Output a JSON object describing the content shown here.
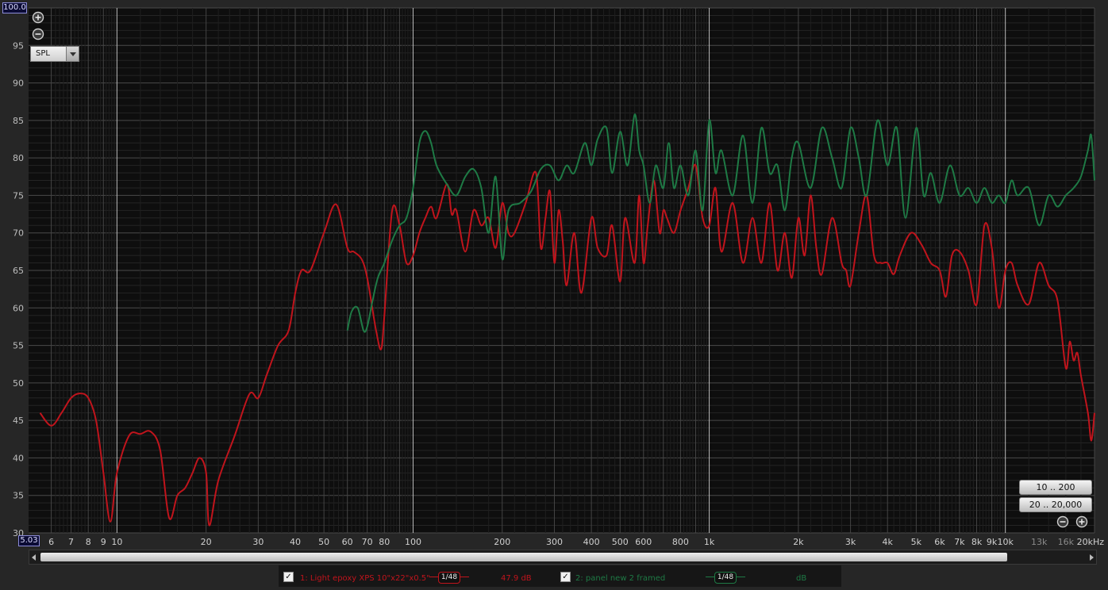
{
  "chart_data": {
    "type": "line",
    "title": "",
    "xlabel": "",
    "ylabel": "",
    "x_scale": "log",
    "xlim": [
      5.03,
      20000
    ],
    "ylim": [
      30,
      100
    ],
    "grid": true,
    "y_ticks": [
      "30",
      "35",
      "40",
      "45",
      "50",
      "55",
      "60",
      "65",
      "70",
      "75",
      "80",
      "85",
      "90",
      "95"
    ],
    "x_ticks": [
      {
        "v": 6,
        "t": "6"
      },
      {
        "v": 7,
        "t": "7"
      },
      {
        "v": 8,
        "t": "8"
      },
      {
        "v": 9,
        "t": "9"
      },
      {
        "v": 10,
        "t": "10"
      },
      {
        "v": 20,
        "t": "20"
      },
      {
        "v": 30,
        "t": "30"
      },
      {
        "v": 40,
        "t": "40"
      },
      {
        "v": 50,
        "t": "50"
      },
      {
        "v": 60,
        "t": "60"
      },
      {
        "v": 70,
        "t": "70"
      },
      {
        "v": 80,
        "t": "80"
      },
      {
        "v": 100,
        "t": "100"
      },
      {
        "v": 200,
        "t": "200"
      },
      {
        "v": 300,
        "t": "300"
      },
      {
        "v": 400,
        "t": "400"
      },
      {
        "v": 500,
        "t": "500"
      },
      {
        "v": 600,
        "t": "600"
      },
      {
        "v": 800,
        "t": "800"
      },
      {
        "v": 1000,
        "t": "1k"
      },
      {
        "v": 2000,
        "t": "2k"
      },
      {
        "v": 3000,
        "t": "3k"
      },
      {
        "v": 4000,
        "t": "4k"
      },
      {
        "v": 5000,
        "t": "5k"
      },
      {
        "v": 6000,
        "t": "6k"
      },
      {
        "v": 7000,
        "t": "7k"
      },
      {
        "v": 8000,
        "t": "8k"
      },
      {
        "v": 9000,
        "t": "9k"
      },
      {
        "v": 10000,
        "t": "10k"
      },
      {
        "v": 13000,
        "t": "13k"
      },
      {
        "v": 16000,
        "t": "16k"
      },
      {
        "v": 20000,
        "t": "20kHz"
      }
    ],
    "series": [
      {
        "name": "1: Light epoxy XPS 10\"x22\"x0.5\"",
        "color": "#c0141c",
        "points": [
          [
            5,
            48.5
          ],
          [
            5.5,
            46
          ],
          [
            6,
            44.3
          ],
          [
            6.5,
            46
          ],
          [
            7,
            48
          ],
          [
            7.5,
            48.6
          ],
          [
            8,
            48
          ],
          [
            8.5,
            45
          ],
          [
            9,
            38
          ],
          [
            9.5,
            31.5
          ],
          [
            10,
            38
          ],
          [
            11,
            43
          ],
          [
            12,
            43.2
          ],
          [
            13,
            43.5
          ],
          [
            14,
            41
          ],
          [
            15,
            32
          ],
          [
            16,
            35
          ],
          [
            17,
            36
          ],
          [
            18,
            38
          ],
          [
            19,
            40
          ],
          [
            20,
            38
          ],
          [
            20.5,
            31
          ],
          [
            22,
            37
          ],
          [
            25,
            43
          ],
          [
            28,
            48.5
          ],
          [
            30,
            48
          ],
          [
            32,
            51
          ],
          [
            35,
            55
          ],
          [
            38,
            57
          ],
          [
            40,
            62
          ],
          [
            42,
            65
          ],
          [
            45,
            65
          ],
          [
            50,
            70
          ],
          [
            55,
            73.8
          ],
          [
            60,
            68
          ],
          [
            63,
            67.5
          ],
          [
            67,
            66.5
          ],
          [
            70,
            64
          ],
          [
            75,
            57
          ],
          [
            78,
            54.5
          ],
          [
            80,
            59
          ],
          [
            85,
            73
          ],
          [
            90,
            71
          ],
          [
            95,
            66
          ],
          [
            100,
            67
          ],
          [
            105,
            70
          ],
          [
            110,
            72
          ],
          [
            115,
            73.5
          ],
          [
            120,
            72
          ],
          [
            130,
            76.5
          ],
          [
            135,
            72.5
          ],
          [
            140,
            73
          ],
          [
            150,
            67.5
          ],
          [
            160,
            73
          ],
          [
            170,
            71
          ],
          [
            180,
            72
          ],
          [
            190,
            68
          ],
          [
            200,
            74
          ],
          [
            210,
            70
          ],
          [
            220,
            70
          ],
          [
            240,
            74
          ],
          [
            260,
            78
          ],
          [
            270,
            68
          ],
          [
            280,
            72
          ],
          [
            290,
            75.5
          ],
          [
            300,
            66
          ],
          [
            310,
            73
          ],
          [
            320,
            69
          ],
          [
            330,
            63
          ],
          [
            350,
            70
          ],
          [
            370,
            62
          ],
          [
            400,
            72
          ],
          [
            420,
            68
          ],
          [
            450,
            67
          ],
          [
            470,
            71
          ],
          [
            500,
            63.5
          ],
          [
            520,
            72
          ],
          [
            560,
            66
          ],
          [
            580,
            75
          ],
          [
            600,
            66
          ],
          [
            620,
            71
          ],
          [
            650,
            77
          ],
          [
            680,
            70
          ],
          [
            700,
            73
          ],
          [
            720,
            72
          ],
          [
            760,
            70
          ],
          [
            800,
            73
          ],
          [
            850,
            76
          ],
          [
            900,
            79
          ],
          [
            950,
            72
          ],
          [
            1000,
            71
          ],
          [
            1050,
            76
          ],
          [
            1100,
            67.5
          ],
          [
            1200,
            74
          ],
          [
            1300,
            66
          ],
          [
            1400,
            72
          ],
          [
            1500,
            66
          ],
          [
            1600,
            74
          ],
          [
            1700,
            65
          ],
          [
            1800,
            70
          ],
          [
            1900,
            64
          ],
          [
            2000,
            72
          ],
          [
            2100,
            67
          ],
          [
            2200,
            75
          ],
          [
            2300,
            68
          ],
          [
            2400,
            64.5
          ],
          [
            2600,
            72
          ],
          [
            2800,
            66
          ],
          [
            2900,
            65
          ],
          [
            3000,
            63
          ],
          [
            3200,
            70
          ],
          [
            3400,
            75
          ],
          [
            3600,
            67
          ],
          [
            3800,
            66
          ],
          [
            4000,
            66
          ],
          [
            4200,
            64.5
          ],
          [
            4400,
            67
          ],
          [
            4800,
            70
          ],
          [
            5200,
            68.5
          ],
          [
            5600,
            66
          ],
          [
            6000,
            65
          ],
          [
            6300,
            61.5
          ],
          [
            6600,
            67
          ],
          [
            7000,
            67.5
          ],
          [
            7500,
            65
          ],
          [
            8000,
            60.5
          ],
          [
            8500,
            71
          ],
          [
            9000,
            68
          ],
          [
            9500,
            60
          ],
          [
            10000,
            65
          ],
          [
            10500,
            66
          ],
          [
            11000,
            63
          ],
          [
            12000,
            60.5
          ],
          [
            13000,
            66
          ],
          [
            14000,
            63
          ],
          [
            15000,
            61
          ],
          [
            16000,
            52
          ],
          [
            16500,
            55.5
          ],
          [
            17000,
            53
          ],
          [
            17500,
            54
          ],
          [
            18000,
            51
          ],
          [
            19000,
            46
          ],
          [
            19500,
            42.3
          ],
          [
            20000,
            46
          ]
        ]
      },
      {
        "name": "2: panel new 2 framed",
        "color": "#1e7a45",
        "points": [
          [
            60,
            57
          ],
          [
            62,
            59.5
          ],
          [
            65,
            60
          ],
          [
            68,
            57
          ],
          [
            70,
            57.5
          ],
          [
            73,
            61
          ],
          [
            76,
            64
          ],
          [
            80,
            66
          ],
          [
            85,
            69
          ],
          [
            90,
            71
          ],
          [
            95,
            72
          ],
          [
            100,
            76
          ],
          [
            105,
            82
          ],
          [
            110,
            83.6
          ],
          [
            115,
            82
          ],
          [
            120,
            79
          ],
          [
            130,
            76.5
          ],
          [
            140,
            75
          ],
          [
            150,
            77.5
          ],
          [
            160,
            78.5
          ],
          [
            170,
            76
          ],
          [
            180,
            70
          ],
          [
            190,
            77.5
          ],
          [
            200,
            66.5
          ],
          [
            210,
            73
          ],
          [
            230,
            74
          ],
          [
            250,
            75.5
          ],
          [
            270,
            78.5
          ],
          [
            290,
            79
          ],
          [
            310,
            77
          ],
          [
            330,
            79
          ],
          [
            350,
            78
          ],
          [
            380,
            82
          ],
          [
            400,
            79
          ],
          [
            420,
            82.5
          ],
          [
            450,
            84
          ],
          [
            470,
            78
          ],
          [
            500,
            83.5
          ],
          [
            530,
            79
          ],
          [
            560,
            85.8
          ],
          [
            580,
            81
          ],
          [
            600,
            79
          ],
          [
            630,
            74
          ],
          [
            660,
            79
          ],
          [
            700,
            76
          ],
          [
            730,
            82
          ],
          [
            760,
            76
          ],
          [
            800,
            79
          ],
          [
            850,
            75
          ],
          [
            900,
            81
          ],
          [
            950,
            73
          ],
          [
            1000,
            85
          ],
          [
            1050,
            78
          ],
          [
            1100,
            81
          ],
          [
            1200,
            75
          ],
          [
            1300,
            83
          ],
          [
            1400,
            74
          ],
          [
            1500,
            84
          ],
          [
            1600,
            78
          ],
          [
            1700,
            79
          ],
          [
            1800,
            73
          ],
          [
            1900,
            80
          ],
          [
            2000,
            82
          ],
          [
            2200,
            76
          ],
          [
            2400,
            84
          ],
          [
            2600,
            80
          ],
          [
            2800,
            76
          ],
          [
            3000,
            84
          ],
          [
            3200,
            80
          ],
          [
            3400,
            75
          ],
          [
            3700,
            85
          ],
          [
            4000,
            79
          ],
          [
            4300,
            84
          ],
          [
            4600,
            72
          ],
          [
            5000,
            84
          ],
          [
            5300,
            75
          ],
          [
            5600,
            78
          ],
          [
            6000,
            74
          ],
          [
            6500,
            79
          ],
          [
            7000,
            75
          ],
          [
            7500,
            76
          ],
          [
            8000,
            74
          ],
          [
            8500,
            76
          ],
          [
            9000,
            74
          ],
          [
            9500,
            75
          ],
          [
            10000,
            74
          ],
          [
            10500,
            77
          ],
          [
            11000,
            75
          ],
          [
            12000,
            76
          ],
          [
            13000,
            71
          ],
          [
            14000,
            75
          ],
          [
            15000,
            73.5
          ],
          [
            16000,
            75
          ],
          [
            17000,
            76
          ],
          [
            18000,
            77.5
          ],
          [
            19000,
            81
          ],
          [
            19500,
            83
          ],
          [
            20000,
            77
          ]
        ]
      }
    ]
  },
  "controls": {
    "y_max": "100.0",
    "x_min": "5.03",
    "spl_select": "SPL",
    "range_button_1": "10 .. 200",
    "range_button_2": "20 .. 20,000"
  },
  "legend": {
    "items": [
      {
        "check": "✓",
        "label": "1: Light epoxy XPS 10\"x22\"x0.5\"",
        "smoothing": "1/48",
        "value": "47.9 dB",
        "color": "#c0141c"
      },
      {
        "check": "✓",
        "label": "2: panel new 2 framed",
        "smoothing": "1/48",
        "value": "dB",
        "color": "#1e7a45"
      }
    ]
  },
  "icons": [
    "zoom-in-icon",
    "zoom-out-icon",
    "scroll-left-icon",
    "scroll-right-icon"
  ]
}
